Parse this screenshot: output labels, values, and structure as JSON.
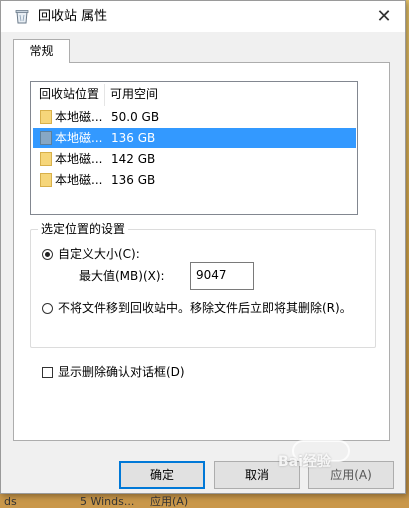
{
  "window": {
    "title": "回收站 属性",
    "close_glyph": "✕"
  },
  "tabs": [
    {
      "label": "常规",
      "selected": true
    }
  ],
  "location_list": {
    "headers": {
      "location": "回收站位置",
      "space": "可用空间"
    },
    "rows": [
      {
        "name": "本地磁...",
        "space": "50.0 GB",
        "selected": false
      },
      {
        "name": "本地磁...",
        "space": "136 GB",
        "selected": true
      },
      {
        "name": "本地磁...",
        "space": "142 GB",
        "selected": false
      },
      {
        "name": "本地磁...",
        "space": "136 GB",
        "selected": false
      }
    ]
  },
  "settings": {
    "legend": "选定位置的设置",
    "custom_size_label": "自定义大小(C):",
    "custom_size_checked": true,
    "max_size_label": "最大值(MB)(X):",
    "max_size_value": "9047",
    "delete_immediately_label": "不将文件移到回收站中。移除文件后立即将其删除(R)。",
    "delete_immediately_checked": false
  },
  "confirm_dialog": {
    "label": "显示删除确认对话框(D)",
    "checked": false
  },
  "buttons": {
    "ok": "确定",
    "cancel": "取消",
    "apply": "应用(A)"
  },
  "watermark": {
    "text": "Bai经验"
  },
  "background_fragments": [
    "ds",
    "5 Winds...",
    "应用(A)"
  ],
  "colors": {
    "selection": "#3399ff",
    "primary_button_border": "#0078d7",
    "desktop": "#d9a94b"
  }
}
